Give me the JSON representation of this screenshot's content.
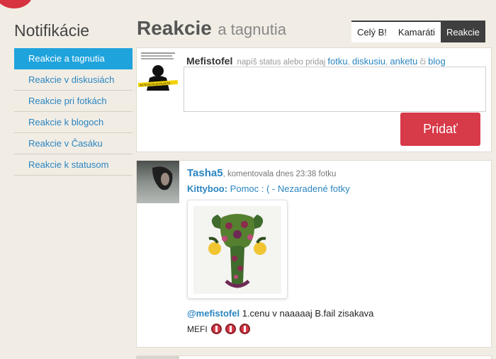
{
  "sidebar": {
    "title": "Notifikácie",
    "items": [
      {
        "label": "Reakcie a tagnutia",
        "active": true
      },
      {
        "label": "Reakcie v diskusiách",
        "active": false
      },
      {
        "label": "Reakcie pri fotkách",
        "active": false
      },
      {
        "label": "Reakcie k blogoch",
        "active": false
      },
      {
        "label": "Reakcie v Časáku",
        "active": false
      },
      {
        "label": "Reakcie k statusom",
        "active": false
      }
    ]
  },
  "header": {
    "title": "Reakcie",
    "subtitle": "a tagnutia",
    "filters": [
      {
        "label": "Celý B!",
        "active": false
      },
      {
        "label": "Kamaráti",
        "active": false
      },
      {
        "label": "Reakcie",
        "active": true
      }
    ]
  },
  "composer": {
    "username": "Mefistofel",
    "prompt": "napíš status alebo pridaj",
    "links": [
      "fotku",
      "diskusiu",
      "anketu",
      "blog"
    ],
    "separator_or": "či",
    "textarea_value": "",
    "submit_label": "Pridať",
    "avatar_text": "ACTA ACTA ACTA ACTA"
  },
  "feed": {
    "items": [
      {
        "username": "Tasha5",
        "action": ", komentovala dnes 23:38 fotku",
        "context_user": "Kittyboo:",
        "context_link": "Pomoc : ( - Nezaradené fotky",
        "comment_mention": "@mefistofel",
        "comment_text": " 1.cenu v naaaaaj B.fail zisakava",
        "reaction_label": "MEFI",
        "reaction_count": 3
      }
    ]
  },
  "colors": {
    "accent_blue": "#1fa3dc",
    "link_blue": "#2b85c0",
    "submit_red": "#d73a48",
    "background": "#f1ede5"
  }
}
